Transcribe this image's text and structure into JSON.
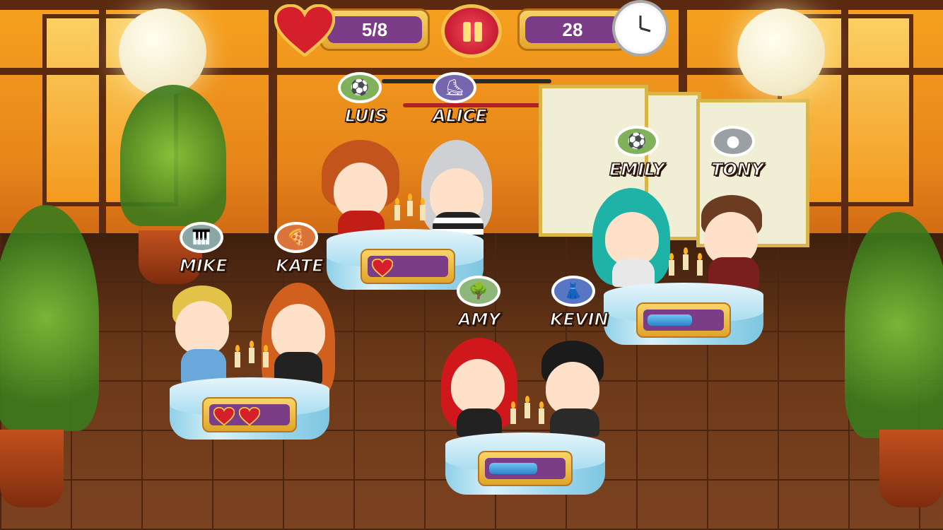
{
  "hud": {
    "hearts": "5/8",
    "time": "28"
  },
  "icons": {
    "life": "heart-icon",
    "pause": "pause-icon",
    "timer": "clock-icon"
  },
  "customers": [
    {
      "name": "LUIS",
      "interest": "soccer-ball-icon"
    },
    {
      "name": "ALICE",
      "interest": "skateboard-icon"
    },
    {
      "name": "EMILY",
      "interest": "soccer-ball-icon"
    },
    {
      "name": "TONY",
      "interest": "apple-logo-icon"
    },
    {
      "name": "MIKE",
      "interest": "piano-keys-icon"
    },
    {
      "name": "KATE",
      "interest": "pizza-slice-icon"
    },
    {
      "name": "AMY",
      "interest": "tree-icon"
    },
    {
      "name": "KEVIN",
      "interest": "dress-icon"
    }
  ],
  "tables": [
    {
      "couple": "LUIS & ALICE",
      "hearts": 1,
      "progress": null
    },
    {
      "couple": "EMILY & TONY",
      "hearts": 0,
      "progress": 0.55
    },
    {
      "couple": "MIKE & KATE",
      "hearts": 2,
      "progress": null
    },
    {
      "couple": "AMY & KEVIN",
      "hearts": 0,
      "progress": 0.6
    }
  ],
  "colors": {
    "hud_purple": "#7b3d87",
    "hud_gold": "#e3a52a",
    "heart_red": "#d61f2d",
    "progress_blue": "#2d83c9"
  }
}
